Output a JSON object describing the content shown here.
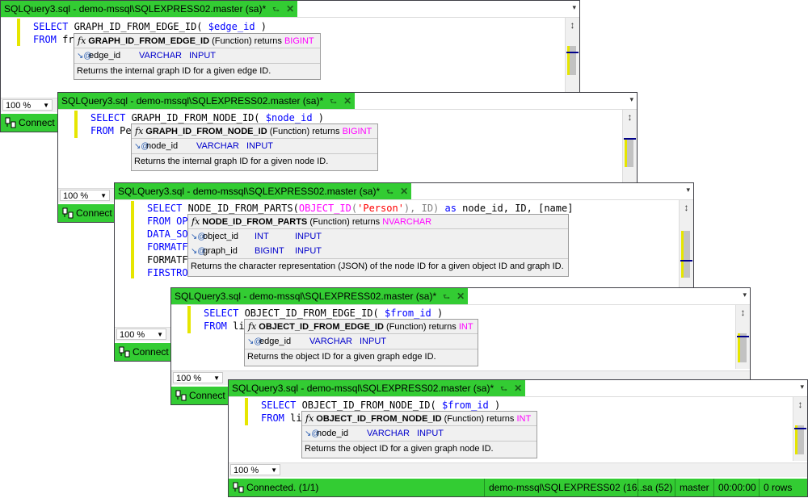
{
  "windows": [
    {
      "tab_title": "SQLQuery3.sql - demo-mssql\\SQLEXPRESS02.master (sa)*",
      "line1": {
        "kw": "SELECT",
        "fn": " GRAPH_ID_FROM_EDGE_ID(",
        "var": " $edge_id",
        "rest": " )"
      },
      "line2": {
        "kw": "FROM",
        "rest": " fr"
      },
      "zoom": "100 %",
      "status": "Connect",
      "tooltip": {
        "fname": "GRAPH_ID_FROM_EDGE_ID",
        "kind": " (Function) returns ",
        "ret": "BIGINT",
        "params": [
          {
            "name": "edge_id",
            "type": "VARCHAR",
            "dir": "INPUT"
          }
        ],
        "desc": "Returns the internal graph ID for a given edge ID."
      }
    },
    {
      "tab_title": "SQLQuery3.sql - demo-mssql\\SQLEXPRESS02.master (sa)*",
      "line1": {
        "kw": "SELECT",
        "fn": " GRAPH_ID_FROM_NODE_ID(",
        "var": " $node_id",
        "rest": " )"
      },
      "line2": {
        "kw": "FROM",
        "rest": " Pe"
      },
      "zoom": "100 %",
      "status": "Connect",
      "tooltip": {
        "fname": "GRAPH_ID_FROM_NODE_ID",
        "kind": " (Function) returns ",
        "ret": "BIGINT",
        "params": [
          {
            "name": "node_id",
            "type": "VARCHAR",
            "dir": "INPUT"
          }
        ],
        "desc": "Returns the internal graph ID for a given node ID."
      }
    },
    {
      "tab_title": "SQLQuery3.sql - demo-mssql\\SQLEXPRESS02.master (sa)*",
      "line1": {
        "kw": "SELECT",
        "fn": " NODE_ID_FROM_PARTS(",
        "fn2": "OBJECT_ID",
        "p1": "(",
        "str": "'Person'",
        "p2": "), ID) ",
        "as": "as",
        "rest": " node_id, ID, [name]"
      },
      "lines": [
        {
          "kw": "FROM OP",
          "rest": ""
        },
        {
          "kw": "DATA_SO",
          "rest": ""
        },
        {
          "kw": "FORMATF",
          "rest": ""
        },
        {
          "kw": "",
          "rest": "FORMATF"
        },
        {
          "kw": "FIRSTRO",
          "rest": ""
        }
      ],
      "zoom": "100 %",
      "status": "Connect",
      "tooltip": {
        "fname": "NODE_ID_FROM_PARTS",
        "kind": " (Function) returns ",
        "ret": "NVARCHAR",
        "params": [
          {
            "name": "object_id",
            "type": "INT",
            "dir": "INPUT"
          },
          {
            "name": "graph_id",
            "type": "BIGINT",
            "dir": "INPUT"
          }
        ],
        "desc": "Returns the character representation (JSON) of the node ID for a given object ID and graph ID."
      }
    },
    {
      "tab_title": "SQLQuery3.sql - demo-mssql\\SQLEXPRESS02.master (sa)*",
      "line1": {
        "kw": "SELECT",
        "fn": " OBJECT_ID_FROM_EDGE_ID(",
        "var": " $from_id",
        "rest": " )"
      },
      "line2": {
        "kw": "FROM",
        "rest": " li"
      },
      "zoom": "100 %",
      "status": "Connect",
      "tooltip": {
        "fname": "OBJECT_ID_FROM_EDGE_ID",
        "kind": " (Function) returns ",
        "ret": "INT",
        "params": [
          {
            "name": "edge_id",
            "type": "VARCHAR",
            "dir": "INPUT"
          }
        ],
        "desc": "Returns the object ID for a given graph edge ID."
      }
    },
    {
      "tab_title": "SQLQuery3.sql - demo-mssql\\SQLEXPRESS02.master (sa)*",
      "line1": {
        "kw": "SELECT",
        "fn": " OBJECT_ID_FROM_NODE_ID(",
        "var": " $from_id",
        "rest": " )"
      },
      "line2": {
        "kw": "FROM",
        "rest": " li"
      },
      "zoom": "100 %",
      "status": "Connected. (1/1)",
      "status_segments": [
        "demo-mssql\\SQLEXPRESS02 (16...",
        "sa (52)",
        "master",
        "00:00:00",
        "0 rows"
      ],
      "tooltip": {
        "fname": "OBJECT_ID_FROM_NODE_ID",
        "kind": " (Function) returns ",
        "ret": "INT",
        "params": [
          {
            "name": "node_id",
            "type": "VARCHAR",
            "dir": "INPUT"
          }
        ],
        "desc": "Returns the object ID for a given graph node ID."
      }
    }
  ],
  "icons": {
    "pin": "pin-icon",
    "close": "close-icon",
    "split": "split-icon",
    "connected": "connected-plug-icon",
    "param": "parameter-icon",
    "function": "function-icon"
  },
  "colors": {
    "tab_active": "#33cc33",
    "keyword": "#0000ff",
    "return_type": "#ff00ff",
    "string": "#ff0000",
    "change_marker": "#e6e600"
  }
}
